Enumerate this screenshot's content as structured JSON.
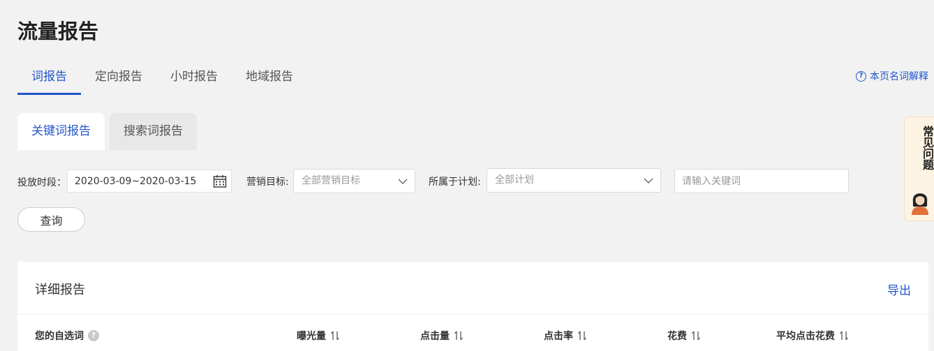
{
  "page_title": "流量报告",
  "tabs": [
    {
      "label": "词报告",
      "active": true
    },
    {
      "label": "定向报告",
      "active": false
    },
    {
      "label": "小时报告",
      "active": false
    },
    {
      "label": "地域报告",
      "active": false
    }
  ],
  "help_link": "本页名词解释",
  "subtabs": [
    {
      "label": "关键词报告",
      "active": true
    },
    {
      "label": "搜索词报告",
      "active": false
    }
  ],
  "filters": {
    "period_label": "投放时段：",
    "period_value": "2020-03-09~2020-03-15",
    "marketing_label": "营销目标:",
    "marketing_placeholder": "全部营销目标",
    "plan_label": "所属于计划:",
    "plan_placeholder": "全部计划",
    "keyword_placeholder": "请输入关键词"
  },
  "query_button": "查询",
  "faq": {
    "label": "常见问题"
  },
  "report": {
    "title": "详细报告",
    "export_label": "导出",
    "columns": [
      "您的自选词",
      "曝光量",
      "点击量",
      "点击率",
      "花费",
      "平均点击花费"
    ]
  },
  "colors": {
    "accent": "#2255cc",
    "background": "#f2f2f2",
    "faq_bg": "#fdf3e2"
  },
  "icons": [
    "help-circle-icon",
    "calendar-icon",
    "chevron-down-icon",
    "question-icon",
    "sort-icon",
    "avatar"
  ]
}
